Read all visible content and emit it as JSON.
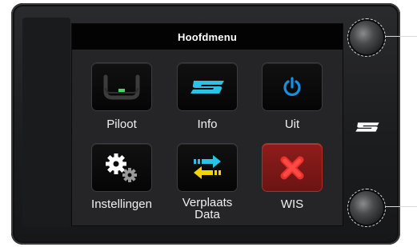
{
  "screen": {
    "title": "Hoofdmenu"
  },
  "menu": {
    "items": [
      {
        "label": "Piloot",
        "icon": "steering-wheel-icon"
      },
      {
        "label": "Info",
        "icon": "brand-logo-icon"
      },
      {
        "label": "Uit",
        "icon": "power-icon"
      },
      {
        "label": "Instellingen",
        "icon": "gears-icon"
      },
      {
        "label_line1": "Verplaats",
        "label_line2": "Data",
        "icon": "transfer-arrows-icon"
      },
      {
        "label": "WIS",
        "icon": "red-x-icon"
      }
    ]
  },
  "colors": {
    "accent_cyan": "#2ac3e6",
    "accent_yellow": "#f2d400",
    "power_blue": "#1a8fe0",
    "wis_red": "#8e1d1b",
    "screen_bg": "#252527",
    "title_bar": "#030303"
  }
}
